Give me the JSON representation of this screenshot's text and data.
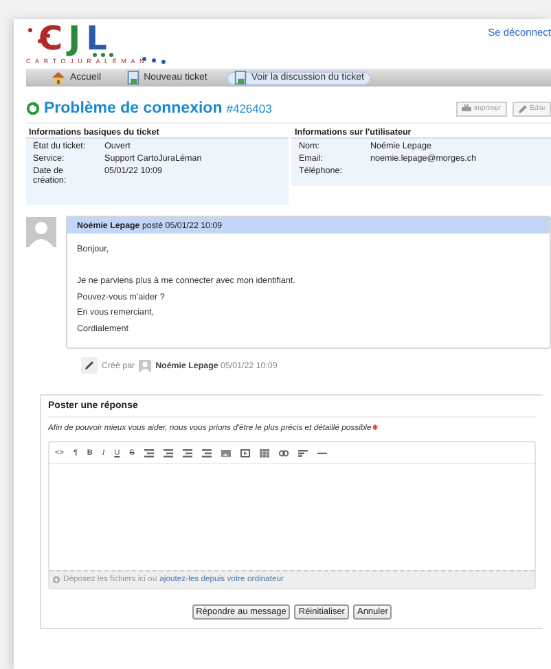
{
  "header": {
    "logo": {
      "letters": [
        "C",
        "J",
        "L"
      ],
      "subtitle": "CARTOJURALÉMAN"
    },
    "logout": "Se déconnect"
  },
  "nav": [
    {
      "label": "Accueil",
      "kind": "home",
      "selected": false
    },
    {
      "label": "Nouveau ticket",
      "kind": "page",
      "selected": false
    },
    {
      "label": "Voir la discussion du ticket",
      "kind": "page",
      "selected": true
    }
  ],
  "ticket": {
    "title": "Problème de connexion",
    "number": "#426403",
    "actions": [
      "Imprimer",
      "Édite"
    ]
  },
  "info": {
    "basic": {
      "heading": "Informations basiques du ticket",
      "rows": [
        {
          "label": "État du ticket:",
          "value": "Ouvert"
        },
        {
          "label": "Service:",
          "value": "Support CartoJuraLéman"
        },
        {
          "label": "Date de création:",
          "value": "05/01/22 10:09"
        }
      ]
    },
    "user": {
      "heading": "Informations sur l'utilisateur",
      "rows": [
        {
          "label": "Nom:",
          "value": "Noémie Lepage"
        },
        {
          "label": "Email:",
          "value": "noemie.lepage@morges.ch"
        },
        {
          "label": "Téléphone:"
        }
      ]
    }
  },
  "message": {
    "author": "Noémie Lepage",
    "posted": "posté 05/01/22 10:09",
    "greeting": "Bonjour,",
    "lines": [
      "Je ne parviens plus à me connecter avec mon identifiant.",
      "Pouvez-vous m'aider ?",
      "En vous remerciant,",
      "Cordialement"
    ]
  },
  "event": {
    "prefix": "Créé par",
    "author": "Noémie Lepage",
    "time": "05/01/22 10:09"
  },
  "reply": {
    "heading": "Poster une réponse",
    "hint": "Afin de pouvoir mieux vous aider, nous vous prions d'être le plus précis et détaillé possible",
    "required": true,
    "toolbar": [
      "<>",
      "¶",
      "B",
      "I",
      "U",
      "S"
    ],
    "drop": {
      "text": "Déposez les fichiers ici ou",
      "link": "ajoutez-les depuis votre ordinateur"
    },
    "buttons": [
      "Répondre au message",
      "Réinitialiser",
      "Annuler"
    ]
  }
}
